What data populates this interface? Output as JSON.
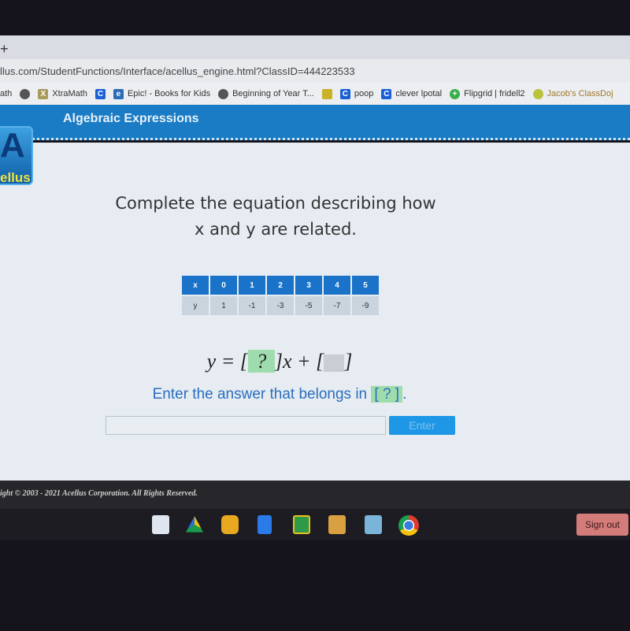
{
  "browser": {
    "new_tab": "+",
    "url": "llus.com/StudentFunctions/Interface/acellus_engine.html?ClassID=444223533",
    "bookmarks": [
      {
        "label": "ath",
        "icon": "none"
      },
      {
        "label": "",
        "icon": "globe-icon"
      },
      {
        "label": "XtraMath",
        "icon": "xtramath-icon"
      },
      {
        "label": "",
        "icon": "clever-icon"
      },
      {
        "label": "Epic! - Books for Kids",
        "icon": "epic-icon"
      },
      {
        "label": "Beginning of Year T...",
        "icon": "globe-icon"
      },
      {
        "label": "",
        "icon": "classroom-icon"
      },
      {
        "label": "poop",
        "icon": "clever-icon"
      },
      {
        "label": "clever lpotal",
        "icon": "clever-icon"
      },
      {
        "label": "Flipgrid | fridell2",
        "icon": "flipgrid-icon"
      },
      {
        "label": "Jacob's ClassDoj",
        "icon": "classdojo-icon"
      }
    ]
  },
  "header": {
    "title": "Algebraic Expressions",
    "logo_text": "ellus"
  },
  "question": {
    "line1": "Complete the equation  describing how",
    "line2": "x and y are related.",
    "table": {
      "x_label": "x",
      "x": [
        "0",
        "1",
        "2",
        "3",
        "4",
        "5"
      ],
      "y_label": "y",
      "y": [
        "1",
        "-1",
        "-3",
        "-5",
        "-7",
        "-9"
      ]
    },
    "equation": {
      "lhs": "y = [",
      "blank": " ? ",
      "mid": "]x + [",
      "end": "]"
    },
    "prompt": "Enter the answer that belongs in ",
    "prompt_box": "[ ? ]",
    "prompt_end": ".",
    "answer_value": "",
    "enter_label": "Enter"
  },
  "footer": {
    "copyright": "ight © 2003 - 2021 Acellus Corporation.  All Rights Reserved."
  },
  "shelf": {
    "apps": [
      "acellus-app-icon",
      "google-drive-icon",
      "play-app-icon",
      "google-docs-icon",
      "google-classroom-icon",
      "app-icon",
      "penguin-app-icon",
      "chrome-icon"
    ],
    "sign_out": "Sign out"
  },
  "colors": {
    "header": "#1a7cc4",
    "table_header": "#1a73c9",
    "highlight": "#9fdcad",
    "prompt": "#2a6dbf",
    "sign_out": "#d47c7a"
  }
}
